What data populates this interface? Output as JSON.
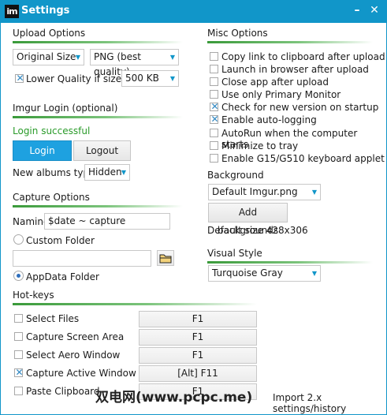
{
  "window": {
    "title": "Settings",
    "logo": "im",
    "minimize_icon": "minus",
    "close_icon": "close"
  },
  "upload_options": {
    "title": "Upload Options",
    "size_select": "Original Size",
    "format_select": "PNG (best quality)",
    "lower_quality_label": "Lower Quality if size >",
    "lower_quality_checked": true,
    "size_threshold": "500 KB"
  },
  "imgur_login": {
    "title": "Imgur Login (optional)",
    "status": "Login successful",
    "login_label": "Login",
    "logout_label": "Logout",
    "albums_label": "New albums type:",
    "albums_value": "Hidden"
  },
  "capture_options": {
    "title": "Capture Options",
    "naming_label": "Naming",
    "naming_value": "$date ~ capture",
    "custom_folder_label": "Custom Folder",
    "custom_folder_value": "",
    "appdata_label": "AppData Folder",
    "selected_folder_option": "AppData Folder"
  },
  "hotkeys": {
    "title": "Hot-keys",
    "items": [
      {
        "label": "Select Files",
        "checked": false,
        "key": "F1"
      },
      {
        "label": "Capture Screen Area",
        "checked": false,
        "key": "F1"
      },
      {
        "label": "Select Aero Window",
        "checked": false,
        "key": "F1"
      },
      {
        "label": "Capture Active Window",
        "checked": true,
        "key": "[Alt] F11"
      },
      {
        "label": "Paste Clipboard",
        "checked": false,
        "key": "F1"
      }
    ]
  },
  "misc_options": {
    "title": "Misc Options",
    "items": [
      {
        "label": "Copy link to clipboard after upload",
        "checked": false
      },
      {
        "label": "Launch in browser after upload",
        "checked": false
      },
      {
        "label": "Close app after upload",
        "checked": false
      },
      {
        "label": "Use only Primary Monitor",
        "checked": false
      },
      {
        "label": "Check for new version on startup",
        "checked": true
      },
      {
        "label": "Enable auto-logging",
        "checked": true
      },
      {
        "label": "AutoRun when the computer starts",
        "checked": false
      },
      {
        "label": "Minimize to tray",
        "checked": false
      },
      {
        "label": "Enable G15/G510 keyboard applet",
        "checked": false
      }
    ]
  },
  "background": {
    "title": "Background",
    "select_value": "Default Imgur.png",
    "add_label": "Add backgrounds",
    "size_text": "Default size 428x306"
  },
  "visual_style": {
    "title": "Visual Style",
    "select_value": "Turquoise Gray"
  },
  "import_label": "Import 2.x settings/history",
  "watermark": "双电网(www.pcpc.me)",
  "colors": {
    "accent": "#1196c9",
    "success": "#2a9b2a",
    "section_underline": "#3a9a3a"
  }
}
